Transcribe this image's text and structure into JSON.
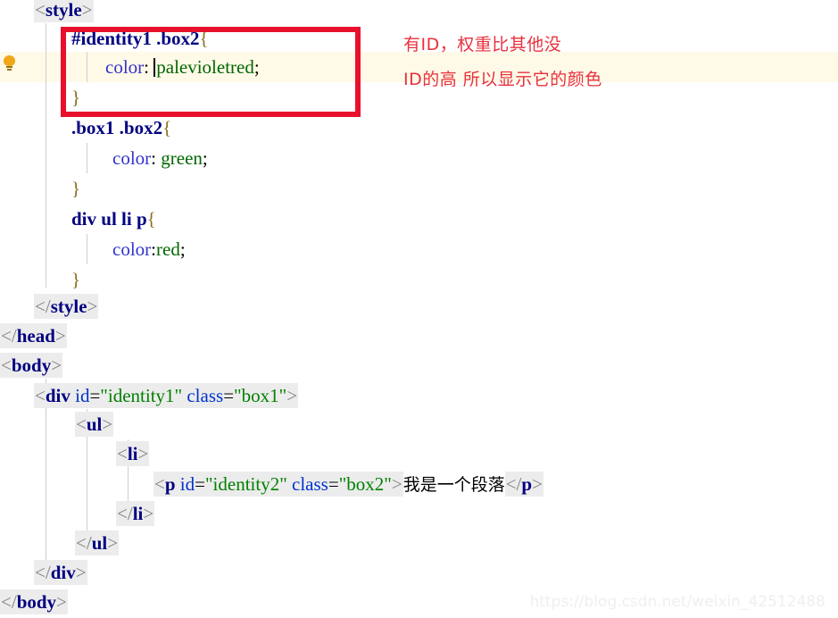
{
  "editor": {
    "kind": "code-editor-screenshot",
    "language": "html-css",
    "background_color": "#ffffff",
    "line_highlight_color": "#fffae8",
    "tag_background_color": "#ececec",
    "gutter": {
      "intention_bulb_icon": "lightbulb-icon",
      "bulb_color": "#f0a818"
    },
    "caret_visible": true
  },
  "code": {
    "l1": {
      "b1": "<",
      "name": "style",
      "b2": ">"
    },
    "l2": {
      "selector": "#identity1 .box2",
      "brace": "{"
    },
    "l3": {
      "prop": "color",
      "colon": ": ",
      "value": "palevioletred",
      "semi": ";"
    },
    "l4": {
      "brace": "}"
    },
    "l5": {
      "selector": ".box1 .box2",
      "brace": "{"
    },
    "l6": {
      "prop": "color",
      "colon": ": ",
      "value": "green",
      "semi": ";"
    },
    "l7": {
      "brace": "}"
    },
    "l8": {
      "selector": "div ul li p",
      "brace": "{"
    },
    "l9": {
      "prop": "color",
      "colon": ":",
      "value": "red",
      "semi": ";"
    },
    "l10": {
      "brace": "}"
    },
    "l11": {
      "b1": "</",
      "name": "style",
      "b2": ">"
    },
    "l12": {
      "b1": "</",
      "name": "head",
      "b2": ">"
    },
    "l13": {
      "b1": "<",
      "name": "body",
      "b2": ">"
    },
    "l14": {
      "b1": "<",
      "name": "div",
      "attr1_name": "id",
      "attr1_value": "\"identity1\"",
      "attr2_name": "class",
      "attr2_value": "\"box1\"",
      "b2": ">"
    },
    "l15": {
      "b1": "<",
      "name": "ul",
      "b2": ">"
    },
    "l16": {
      "b1": "<",
      "name": "li",
      "b2": ">"
    },
    "l17": {
      "b1": "<",
      "name": "p",
      "attr1_name": "id",
      "attr1_value": "\"identity2\"",
      "attr2_name": "class",
      "attr2_value": "\"box2\"",
      "b2": ">",
      "text": "我是一个段落",
      "close_b1": "</",
      "close_name": "p",
      "close_b2": ">"
    },
    "l18": {
      "b1": "</",
      "name": "li",
      "b2": ">"
    },
    "l19": {
      "b1": "</",
      "name": "ul",
      "b2": ">"
    },
    "l20": {
      "b1": "</",
      "name": "div",
      "b2": ">"
    },
    "l21": {
      "b1": "</",
      "name": "body",
      "b2": ">"
    }
  },
  "annotation": {
    "line1": "有ID，权重比其他没",
    "line2": "ID的高 所以显示它的颜色",
    "color": "#e8303c",
    "highlight_box_color": "#e8112d"
  },
  "watermark": {
    "text": "https://blog.csdn.net/weixin_42512488"
  }
}
